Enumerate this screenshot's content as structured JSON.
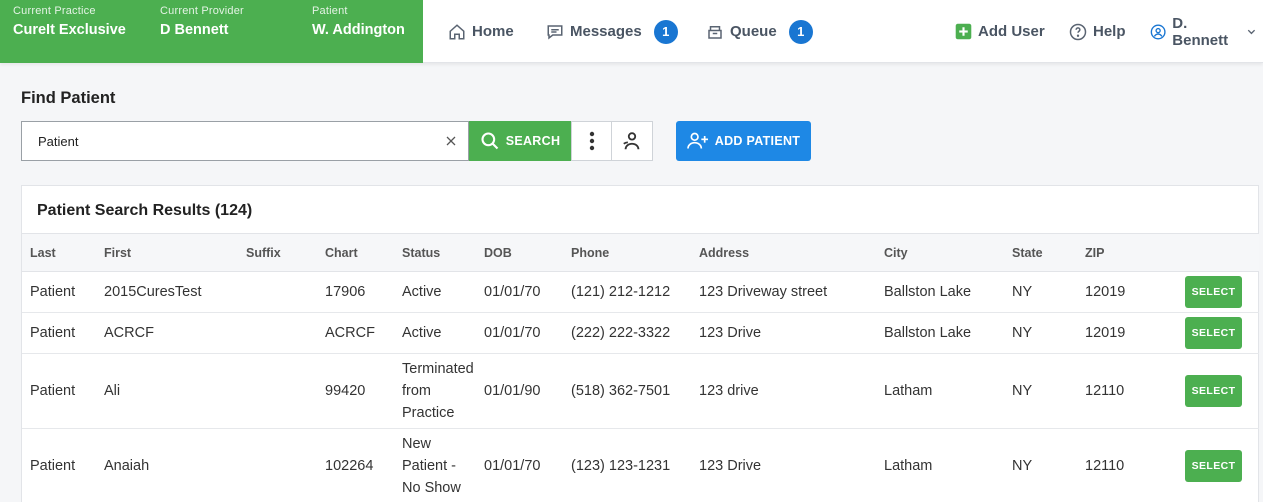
{
  "context": {
    "practice": {
      "label": "Current Practice",
      "value": "CureIt Exclusive"
    },
    "provider": {
      "label": "Current Provider",
      "value": "D Bennett"
    },
    "patient": {
      "label": "Patient",
      "value": "W. Addington"
    }
  },
  "nav": {
    "home": "Home",
    "messages": "Messages",
    "messages_count": "1",
    "queue": "Queue",
    "queue_count": "1",
    "add_user": "Add User",
    "help": "Help",
    "user": "D. Bennett"
  },
  "colors": {
    "green": "#4caf50",
    "blue": "#1e88e5",
    "badge": "#1976d2"
  },
  "find": {
    "title": "Find Patient",
    "search_value": "Patient",
    "search_label": "SEARCH",
    "add_label": "ADD PATIENT"
  },
  "results": {
    "title": "Patient Search Results (124)",
    "columns": [
      "Last",
      "First",
      "Suffix",
      "Chart",
      "Status",
      "DOB",
      "Phone",
      "Address",
      "City",
      "State",
      "ZIP"
    ],
    "select_label": "SELECT",
    "rows": [
      {
        "last": "Patient",
        "first": "2015CuresTest",
        "suffix": "",
        "chart": "17906",
        "status": "Active",
        "dob": "01/01/70",
        "phone": "(121) 212-1212",
        "address": "123 Driveway street",
        "city": "Ballston Lake",
        "state": "NY",
        "zip": "12019"
      },
      {
        "last": "Patient",
        "first": "ACRCF",
        "suffix": "",
        "chart": "ACRCF",
        "status": "Active",
        "dob": "01/01/70",
        "phone": "(222) 222-3322",
        "address": "123 Drive",
        "city": "Ballston Lake",
        "state": "NY",
        "zip": "12019"
      },
      {
        "last": "Patient",
        "first": "Ali",
        "suffix": "",
        "chart": "99420",
        "status": "Terminated from Practice",
        "dob": "01/01/90",
        "phone": "(518) 362-7501",
        "address": "123 drive",
        "city": "Latham",
        "state": "NY",
        "zip": "12110"
      },
      {
        "last": "Patient",
        "first": "Anaiah",
        "suffix": "",
        "chart": "102264",
        "status": "New Patient - No Show",
        "dob": "01/01/70",
        "phone": "(123) 123-1231",
        "address": "123 Drive",
        "city": "Latham",
        "state": "NY",
        "zip": "12110"
      }
    ]
  }
}
